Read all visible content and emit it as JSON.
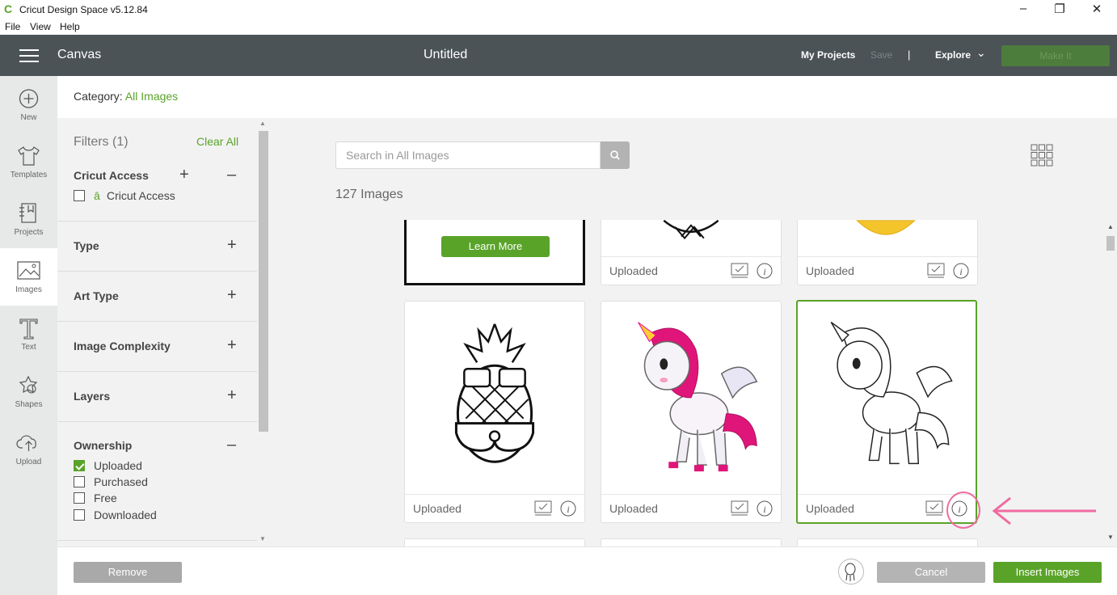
{
  "window": {
    "logo": "C",
    "title": "Cricut Design Space  v5.12.84",
    "menu": [
      "File",
      "View",
      "Help"
    ],
    "controls": {
      "minimize": "–",
      "restore": "❐",
      "close": "✕"
    }
  },
  "header": {
    "section": "Canvas",
    "document_title": "Untitled",
    "my_projects": "My Projects",
    "save": "Save",
    "separator": "|",
    "explore": "Explore",
    "explore_chevron": "⌄",
    "make_it": "Make It"
  },
  "rail": [
    {
      "label": "New",
      "icon": "plus-circle-icon"
    },
    {
      "label": "Templates",
      "icon": "tshirt-icon"
    },
    {
      "label": "Projects",
      "icon": "projects-icon"
    },
    {
      "label": "Images",
      "icon": "image-icon",
      "active": true
    },
    {
      "label": "Text",
      "icon": "text-icon"
    },
    {
      "label": "Shapes",
      "icon": "shapes-icon"
    },
    {
      "label": "Upload",
      "icon": "upload-cloud-icon"
    }
  ],
  "category": {
    "label": "Category:",
    "value": "All Images"
  },
  "filters": {
    "title": "Filters (1)",
    "clear_all": "Clear All",
    "cricut_access": {
      "label": "Cricut Access",
      "plus": "+",
      "minus": "–",
      "option": "Cricut Access",
      "checked": false
    },
    "sections": [
      {
        "label": "Type",
        "toggle": "+"
      },
      {
        "label": "Art Type",
        "toggle": "+"
      },
      {
        "label": "Image Complexity",
        "toggle": "+"
      },
      {
        "label": "Layers",
        "toggle": "+"
      }
    ],
    "ownership": {
      "label": "Ownership",
      "toggle": "–",
      "options": [
        {
          "label": "Uploaded",
          "checked": true
        },
        {
          "label": "Purchased",
          "checked": false
        },
        {
          "label": "Free",
          "checked": false
        },
        {
          "label": "Downloaded",
          "checked": false
        }
      ]
    }
  },
  "search": {
    "placeholder": "Search in All Images",
    "value": ""
  },
  "result_count": "127 Images",
  "promo": {
    "button": "Learn More"
  },
  "cards": [
    {
      "tag": "Uploaded",
      "art": "pineapple-partial",
      "selected": false
    },
    {
      "tag": "Uploaded",
      "art": "lemon-partial",
      "selected": false
    },
    {
      "tag": "Uploaded",
      "art": "pineapple-sunglasses",
      "selected": false
    },
    {
      "tag": "Uploaded",
      "art": "unicorn-color",
      "selected": false
    },
    {
      "tag": "Uploaded",
      "art": "unicorn-outline",
      "selected": true
    }
  ],
  "bottom": {
    "remove": "Remove",
    "cancel": "Cancel",
    "insert": "Insert Images"
  },
  "colors": {
    "accent": "#5aa329",
    "header": "#4b5357",
    "annotation": "#f06ba0"
  }
}
